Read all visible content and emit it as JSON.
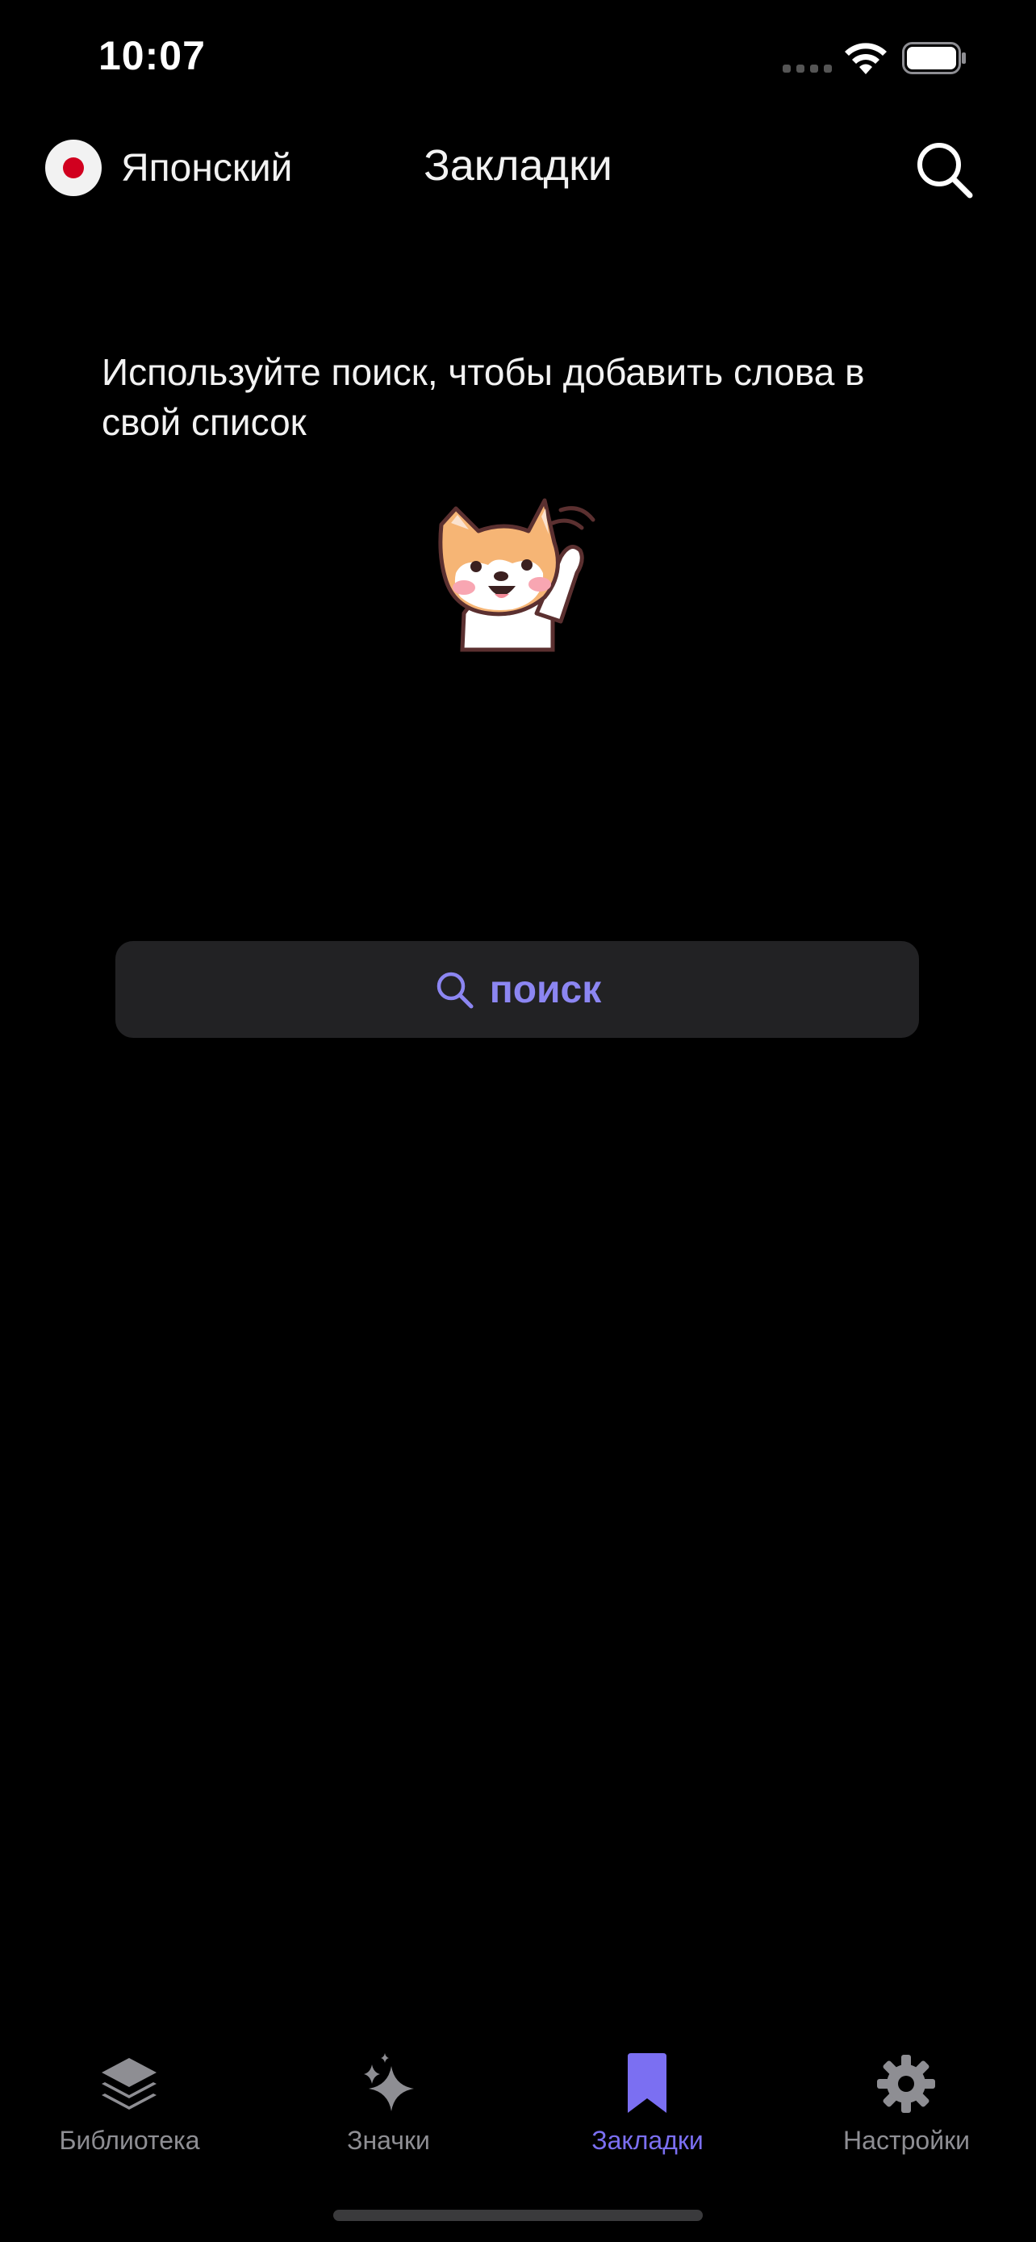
{
  "status_bar": {
    "time": "10:07"
  },
  "header": {
    "language_label": "Японский",
    "title": "Закладки"
  },
  "content": {
    "hint": "Используйте поиск, чтобы добавить слова в свой список",
    "search_button_label": "поиск"
  },
  "tab_bar": {
    "items": [
      {
        "label": "Библиотека",
        "icon": "layers-icon",
        "active": false
      },
      {
        "label": "Значки",
        "icon": "sparkles-icon",
        "active": false
      },
      {
        "label": "Закладки",
        "icon": "bookmark-icon",
        "active": true
      },
      {
        "label": "Настройки",
        "icon": "gear-icon",
        "active": false
      }
    ]
  },
  "colors": {
    "background": "#000000",
    "accent": "#7b6ff2",
    "search_button_bg": "#222224",
    "inactive_tab": "#8e8e93"
  }
}
